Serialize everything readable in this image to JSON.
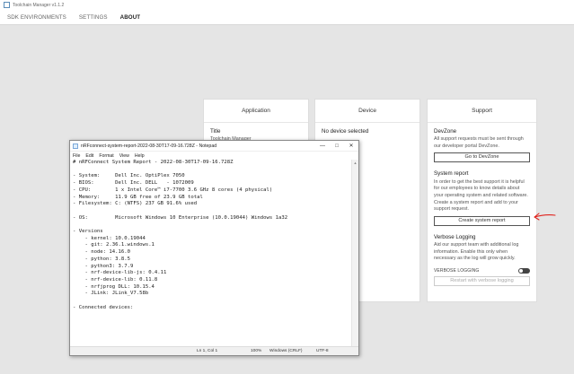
{
  "app": {
    "title": "Toolchain Manager v1.1.2",
    "nav": [
      "SDK ENVIRONMENTS",
      "SETTINGS",
      "ABOUT"
    ],
    "active_nav": "ABOUT"
  },
  "application_card": {
    "header": "Application",
    "title_label": "Title",
    "title_value": "Toolchain Manager"
  },
  "device_card": {
    "header": "Device",
    "status": "No device selected"
  },
  "support_card": {
    "header": "Support",
    "devzone_title": "DevZone",
    "devzone_text": "All support requests must be sent through our developer portal DevZone.",
    "devzone_button": "Go to DevZone",
    "report_title": "System report",
    "report_text": "In order to get the best support it is helpful for our employees to know details about your operating system and related software. Create a system report and add to your support request.",
    "report_button": "Create system report",
    "verbose_title": "Verbose Logging",
    "verbose_text": "Aid our support team with additional log information. Enable this only when necessary as the log will grow quickly.",
    "verbose_toggle_label": "VERBOSE LOGGING",
    "verbose_button": "Restart with verbose logging"
  },
  "annotation": {
    "color": "#e0221c"
  },
  "notepad": {
    "title": "nRFconnect-system-report-2022-08-30T17-09-16.728Z - Notepad",
    "menu": [
      "File",
      "Edit",
      "Format",
      "View",
      "Help"
    ],
    "content": "# nRFConnect System Report - 2022-08-30T17-09-16.728Z\n\n- System:     Dell Inc. OptiPlex 7050\n- BIOS:       Dell Inc. DELL   - 1072009\n- CPU:        1 x Intel Core™ i7-7700 3.6 GHz 8 cores (4 physical)\n- Memory:     11.9 GB free of 23.9 GB total\n- Filesystem: C: (NTFS) 237 GB 91.6% used\n\n- OS:         Microsoft Windows 10 Enterprise (10.0.19044) Windows 1a32\n\n- Versions\n    - kernel: 10.0.19044\n    - git: 2.36.1.windows.1\n    - node: 14.16.0\n    - python: 3.8.5\n    - python3: 3.7.9\n    - nrf-device-lib-js: 0.4.11\n    - nrf-device-lib: 0.11.8\n    - nrfjprog DLL: 10.15.4\n    - JLink: JLink_V7.58b\n\n- Connected devices:",
    "status": {
      "position": "Ln 1, Col 1",
      "zoom": "100%",
      "line_endings": "Windows (CRLF)",
      "encoding": "UTF-8"
    }
  }
}
